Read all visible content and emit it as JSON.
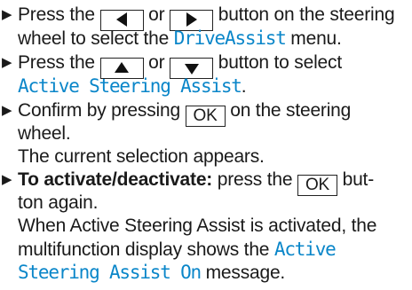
{
  "steps": [
    {
      "l1_a": "Press the ",
      "l1_b": " or ",
      "l1_c": " button on the steering",
      "l2_a": "wheel to select the ",
      "l2_menu": "DriveAssist",
      "l2_b": " menu."
    },
    {
      "l1_a": "Press the ",
      "l1_b": " or ",
      "l1_c": " button to select",
      "l2_menu": "Active Steering Assist",
      "l2_b": "."
    },
    {
      "l1_a": "Confirm by pressing ",
      "l1_ok": "OK",
      "l1_b": " on the steering",
      "l2": "wheel.",
      "l3": "The current selection appears."
    },
    {
      "l1_bold": "To activate/deactivate:",
      "l1_a": " press the ",
      "l1_ok": "OK",
      "l1_b": " but-",
      "l2": "ton again.",
      "l3": "When Active Steering Assist is activated, the",
      "l4_a": "multifunction display shows the ",
      "l4_msg": "Active",
      "l5_msg": "Steering Assist On",
      "l5_b": " message."
    }
  ],
  "icons": {
    "step_marker": "black-right-triangle-icon",
    "left": "left-arrow-button-icon",
    "right": "right-arrow-button-icon",
    "up": "up-arrow-button-icon",
    "down": "down-arrow-button-icon"
  },
  "colors": {
    "display_text": "#0a86c9",
    "body_text": "#1a1a1a"
  }
}
